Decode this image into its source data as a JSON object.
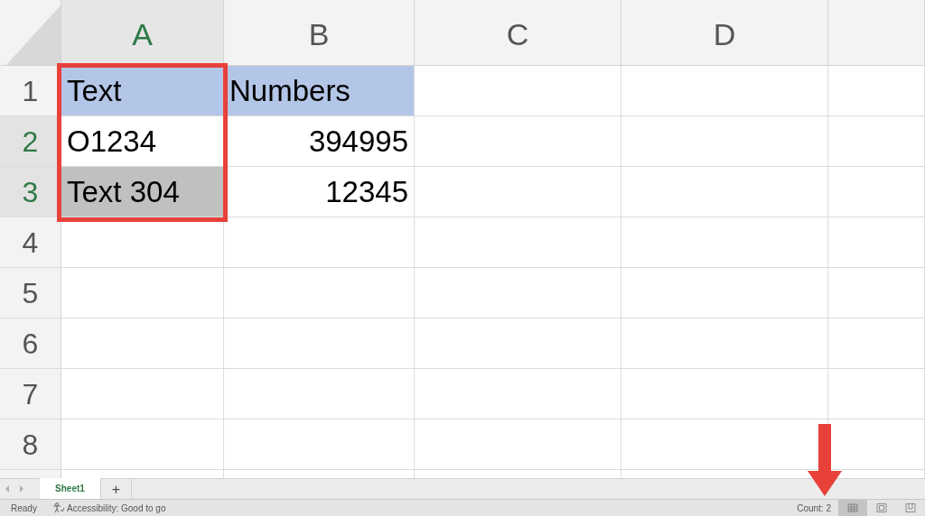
{
  "columns": [
    {
      "label": "A",
      "selected": true
    },
    {
      "label": "B",
      "selected": false
    },
    {
      "label": "C",
      "selected": false
    },
    {
      "label": "D",
      "selected": false
    }
  ],
  "rows": [
    {
      "label": "1",
      "selected": false,
      "cells": [
        {
          "text": "Text",
          "kind": "text",
          "color": "#b4c6e7"
        },
        {
          "text": "Numbers",
          "kind": "text",
          "color": "#b4c6e7"
        }
      ]
    },
    {
      "label": "2",
      "selected": true,
      "cells": [
        {
          "text": "O1234",
          "kind": "text"
        },
        {
          "text": "394995",
          "kind": "number"
        }
      ]
    },
    {
      "label": "3",
      "selected": true,
      "cells": [
        {
          "text": "Text 304",
          "kind": "text",
          "color": "#c0c0c0"
        },
        {
          "text": "12345",
          "kind": "number"
        }
      ]
    },
    {
      "label": "4",
      "selected": false,
      "cells": []
    },
    {
      "label": "5",
      "selected": false,
      "cells": []
    },
    {
      "label": "6",
      "selected": false,
      "cells": []
    },
    {
      "label": "7",
      "selected": false,
      "cells": []
    },
    {
      "label": "8",
      "selected": false,
      "cells": []
    }
  ],
  "sheet_tabs": [
    {
      "label": "Sheet1",
      "selected": true
    }
  ],
  "add_sheet": "+",
  "status_bar": {
    "state": "Ready",
    "accessibility": "Accessibility: Good to go",
    "count": "Count: 2"
  },
  "view_buttons": [
    {
      "kind": "normal",
      "selected": true
    },
    {
      "kind": "page-layout",
      "selected": false
    },
    {
      "kind": "page-break",
      "selected": false
    }
  ]
}
